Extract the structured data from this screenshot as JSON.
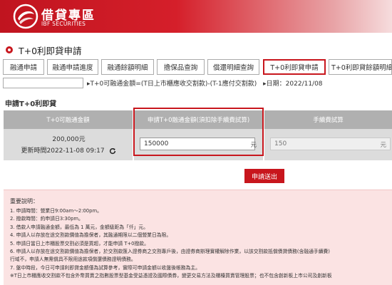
{
  "header": {
    "title": "借貸專區",
    "subtitle": "IBF SECURITIES",
    "brand_color": "#c8161d"
  },
  "page": {
    "title": "T+0利即貸申請"
  },
  "tabs": [
    {
      "label": "融通申請",
      "active": false
    },
    {
      "label": "融通申請進度",
      "active": false
    },
    {
      "label": "融通餘額明細",
      "active": false
    },
    {
      "label": "擔保品查詢",
      "active": false
    },
    {
      "label": "償還明細查詢",
      "active": false
    },
    {
      "label": "T+0利即貸申請",
      "active": true
    },
    {
      "label": "T+0利即貸餘額明細",
      "active": false
    }
  ],
  "info": {
    "account_value": "",
    "description": "▸T+0可融通金額=(T日上市櫃應收交割款)-(T-1應付交割款)",
    "date": "▸日期：2022/11/08"
  },
  "form": {
    "section_label": "申請T+0利即貸",
    "headers": {
      "available": "T+0可融通金額",
      "apply_amount": "申請T+0融通金額(須扣除手續費試算)",
      "fee": "手續費試算"
    },
    "available_amount": "200,000元",
    "updated_at": "更新時間2022-11-08 09:17",
    "apply_amount_value": "150000",
    "apply_amount_unit": "元",
    "fee_value": "150",
    "fee_unit": "元",
    "submit_label": "申請送出"
  },
  "notes": {
    "title": "重要說明：",
    "items": [
      "1. 申請時間：營業日9:00am～2:00pm。",
      "2. 撥款時間：約申請日3:30pm。",
      "3. 借款人申請融通金額，最低為 1 萬元，金額級距為「仟」元。",
      "4. 申請人以存放在途交割款價值為擔保者，其融通期限以二個營業日為限。",
      "5. 申請日當日上市櫃股票交割必須是買超，才能申請 T+0撥款。",
      "6. 申請人以存放在途交割款價值為擔保者，於交割款匯入證券商之交割專戶後，由證券商辦理實權解除作業，以該交割款抵償債貸債務(含融通手續費)",
      "   行域不，申請人無需償具不限用途款項償還債務證明債務。",
      "7. 盤中時段，今日可申請利即貸金額僅為試算參考，實際可申請金額以收盤後帳務為主。",
      "※T日上市櫃應收交割款不包含外幣買賣之指數股票型基金受益憑證及國際債券，變更交易方法及櫃檯買賣管理股票；也不包含創新板上市公司及創新板"
    ]
  }
}
